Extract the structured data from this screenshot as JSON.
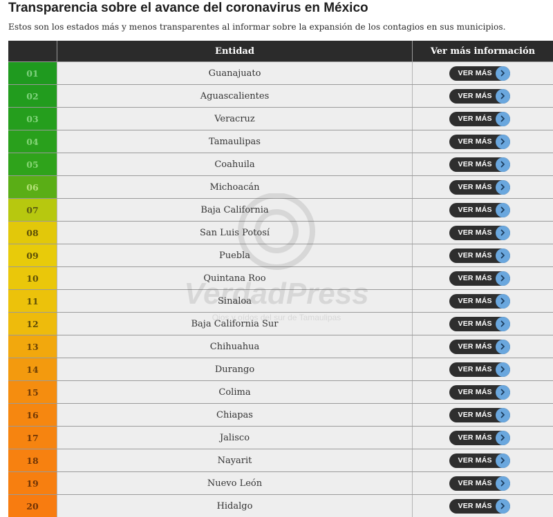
{
  "page": {
    "title": "Transparencia sobre el avance del coronavirus en México",
    "subtitle": "Estos son los estados más y menos transparentes al informar sobre la expansión de los contagios en sus municipios."
  },
  "table": {
    "headers": {
      "rank": "",
      "entity": "Entidad",
      "more": "Ver más información"
    },
    "button_label": "VER MÁS",
    "rows": [
      {
        "rank": "01",
        "entity": "Guanajuato",
        "color": "#1f9a1f",
        "text_color": "#7fd17f"
      },
      {
        "rank": "02",
        "entity": "Aguascalientes",
        "color": "#229c1e",
        "text_color": "#80d47d"
      },
      {
        "rank": "03",
        "entity": "Veracruz",
        "color": "#259e1d",
        "text_color": "#82d47b"
      },
      {
        "rank": "04",
        "entity": "Tamaulipas",
        "color": "#29a01c",
        "text_color": "#85d578"
      },
      {
        "rank": "05",
        "entity": "Coahuila",
        "color": "#2fa31b",
        "text_color": "#88d675"
      },
      {
        "rank": "06",
        "entity": "Michoacán",
        "color": "#5aae16",
        "text_color": "#b7e27a"
      },
      {
        "rank": "07",
        "entity": "Baja California",
        "color": "#b7c80f",
        "text_color": "#5a5a12"
      },
      {
        "rank": "08",
        "entity": "San Luis Potosí",
        "color": "#e2c80a",
        "text_color": "#5c4f08"
      },
      {
        "rank": "09",
        "entity": "Puebla",
        "color": "#e8cb0a",
        "text_color": "#5c4f08"
      },
      {
        "rank": "10",
        "entity": "Quintana Roo",
        "color": "#eac70a",
        "text_color": "#5c4f08"
      },
      {
        "rank": "11",
        "entity": "Sinaloa",
        "color": "#ecc20b",
        "text_color": "#5c4f08"
      },
      {
        "rank": "12",
        "entity": "Baja California Sur",
        "color": "#eebb0c",
        "text_color": "#5c4a08"
      },
      {
        "rank": "13",
        "entity": "Chihuahua",
        "color": "#f2a80d",
        "text_color": "#6b4306"
      },
      {
        "rank": "14",
        "entity": "Durango",
        "color": "#f39a0e",
        "text_color": "#6b3e06"
      },
      {
        "rank": "15",
        "entity": "Colima",
        "color": "#f58d0f",
        "text_color": "#6e3906"
      },
      {
        "rank": "16",
        "entity": "Chiapas",
        "color": "#f68710",
        "text_color": "#6e3706"
      },
      {
        "rank": "17",
        "entity": "Jalisco",
        "color": "#f68410",
        "text_color": "#6e3506"
      },
      {
        "rank": "18",
        "entity": "Nayarit",
        "color": "#f78110",
        "text_color": "#6e3406"
      },
      {
        "rank": "19",
        "entity": "Nuevo León",
        "color": "#f77f10",
        "text_color": "#6e3306"
      },
      {
        "rank": "20",
        "entity": "Hidalgo",
        "color": "#f87c10",
        "text_color": "#6e3206"
      }
    ]
  },
  "watermark": {
    "brand": "VerdadPress",
    "tagline": "Ojos y oídos del sur de Tamaulipas"
  }
}
